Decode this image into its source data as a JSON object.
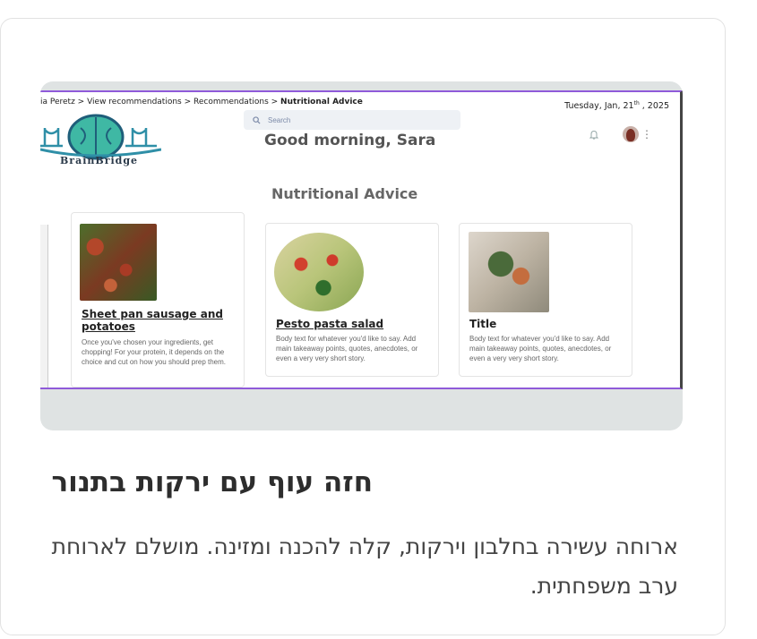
{
  "preview": {
    "breadcrumb": {
      "prefix": "ia Peretz  >  View recommendations  >  Recommendations  >  ",
      "current": "Nutritional Advice"
    },
    "date": {
      "day": "Tuesday,  Jan, 21",
      "sup": "th",
      "year": " , 2025"
    },
    "search": {
      "placeholder": "Search",
      "icon": "search-icon"
    },
    "brand": "BrainBridge",
    "greeting": "Good morning, Sara",
    "section_title": "Nutritional Advice",
    "cards": [
      {
        "title": "Sheet pan sausage and potatoes",
        "body": "Once you've chosen your ingredients, get chopping! For your protein, it depends on the choice and cut on how you should prep them."
      },
      {
        "title": "Pesto pasta salad",
        "body": "Body text for whatever you'd like to say. Add main takeaway points, quotes, anecdotes, or even a very very short story."
      },
      {
        "title": "Title",
        "body": "Body text for whatever you'd like to say. Add main takeaway points, quotes, anecdotes, or even a very very short story."
      }
    ]
  },
  "article": {
    "title": "חזה עוף עם ירקות בתנור",
    "description": "ארוחה עשירה בחלבון וירקות, קלה להכנה ומזינה. מושלם לארוחת ערב משפחתית."
  },
  "colors": {
    "accent": "#8f5ad9",
    "preview_bg": "#dfe3e3",
    "logo_teal": "#2fa7a0"
  }
}
